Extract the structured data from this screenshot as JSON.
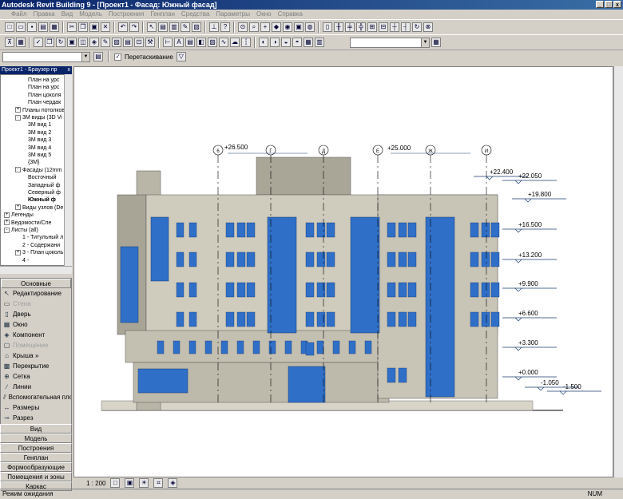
{
  "window": {
    "title": "Autodesk Revit Building 9 - [Проект1 - Фасад: Южный фасад]",
    "controls": [
      "_",
      "□",
      "x"
    ]
  },
  "menu": [
    "Файл",
    "Правка",
    "Вид",
    "Модель",
    "Построения",
    "Генплан",
    "Средства",
    "Параметры",
    "Окно",
    "Справка"
  ],
  "toolbar3": {
    "checkbox_label": "Перетаскивание",
    "checked": true
  },
  "browser": {
    "title": "Проект1 - Браузер пр",
    "close": "x",
    "rows": [
      {
        "text": "План на урс",
        "indent": 3
      },
      {
        "text": "План на урс",
        "indent": 3
      },
      {
        "text": "План цоколя",
        "indent": 3
      },
      {
        "text": "План чердак",
        "indent": 3
      },
      {
        "text": "Планы потолков",
        "indent": 2,
        "toggle": "+"
      },
      {
        "text": "3М виды (3D Vi",
        "indent": 2,
        "toggle": "-"
      },
      {
        "text": "3М вид 1",
        "indent": 3
      },
      {
        "text": "3М вид 2",
        "indent": 3
      },
      {
        "text": "3М вид 3",
        "indent": 3
      },
      {
        "text": "3М вид 4",
        "indent": 3
      },
      {
        "text": "3М вид 5",
        "indent": 3
      },
      {
        "text": "{3М}",
        "indent": 3
      },
      {
        "text": "Фасады (12mm",
        "indent": 2,
        "toggle": "-"
      },
      {
        "text": "Восточный",
        "indent": 3
      },
      {
        "text": "Западный ф",
        "indent": 3
      },
      {
        "text": "Северный ф",
        "indent": 3
      },
      {
        "text": "Южный ф",
        "indent": 3,
        "bold": true
      },
      {
        "text": "Виды узлов (De",
        "indent": 2,
        "toggle": "+"
      },
      {
        "text": "Легенды",
        "indent": 0,
        "toggle": "+"
      },
      {
        "text": "Ведомости/Спе",
        "indent": 0,
        "toggle": "+"
      },
      {
        "text": "Листы (all)",
        "indent": 0,
        "toggle": "-"
      },
      {
        "text": "1 - Титульный л",
        "indent": 2
      },
      {
        "text": "2 - Содержани",
        "indent": 2
      },
      {
        "text": "3 - План цоколь",
        "indent": 2,
        "toggle": "+"
      },
      {
        "text": "4 -",
        "indent": 2
      }
    ]
  },
  "design_bar": {
    "active_tab": "Основные",
    "tools": [
      {
        "label": "Редактирование",
        "icon": "arrow-icon",
        "glyph": "↖",
        "disabled": false
      },
      {
        "label": "Стена",
        "icon": "wall-icon",
        "glyph": "▭",
        "disabled": true
      },
      {
        "label": "Дверь",
        "icon": "door-icon",
        "glyph": "▯",
        "disabled": false
      },
      {
        "label": "Окно",
        "icon": "window-icon",
        "glyph": "▦",
        "disabled": false
      },
      {
        "label": "Компонент",
        "icon": "component-icon",
        "glyph": "◈",
        "disabled": false
      },
      {
        "label": "Помещение",
        "icon": "room-icon",
        "glyph": "▢",
        "disabled": true
      },
      {
        "label": "Крыша »",
        "icon": "roof-icon",
        "glyph": "⌂",
        "disabled": false
      },
      {
        "label": "Перекрытие",
        "icon": "floor-icon",
        "glyph": "▩",
        "disabled": false
      },
      {
        "label": "Сетка",
        "icon": "grid-icon",
        "glyph": "⊕",
        "disabled": false
      },
      {
        "label": "Линии",
        "icon": "lines-icon",
        "glyph": "∕",
        "disabled": false
      },
      {
        "label": "Вспомогательная пло",
        "icon": "ref-plane-icon",
        "glyph": "⫽",
        "disabled": false
      },
      {
        "label": "Размеры",
        "icon": "dimension-icon",
        "glyph": "↔",
        "disabled": false
      },
      {
        "label": "Разрез",
        "icon": "section-icon",
        "glyph": "⊸",
        "disabled": false
      }
    ],
    "tabs": [
      "Вид",
      "Модель",
      "Построения",
      "Генплан",
      "Формообразующие",
      "Помещения и зоны",
      "Каркас"
    ]
  },
  "drawing": {
    "grid_labels": [
      "6",
      "Г",
      "Д",
      "Е",
      "Ж",
      "И"
    ],
    "levels": [
      "+22.400",
      "+22.050",
      "+19.800",
      "+16.500",
      "+13.200",
      "+9.900",
      "+6.600",
      "+3.300",
      "+0.000",
      "-1.050",
      "-1.500"
    ],
    "top_marks": [
      "+26.500",
      "+25.000"
    ]
  },
  "viewbar": {
    "scale": "1 : 200"
  },
  "status": {
    "text": "Режим ожидания",
    "num": "NUM"
  }
}
